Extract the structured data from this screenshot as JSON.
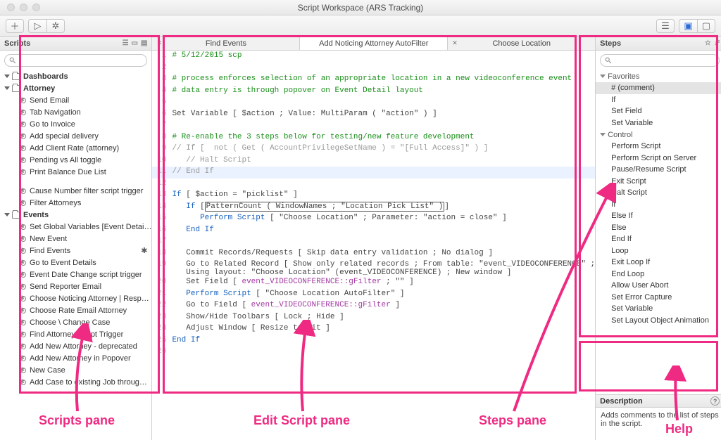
{
  "window": {
    "title": "Script Workspace (ARS Tracking)"
  },
  "scripts": {
    "header": "Scripts",
    "searchPlaceholder": "",
    "folders": [
      {
        "name": "Dashboards",
        "items": []
      },
      {
        "name": "Attorney",
        "items": [
          "Send Email",
          "Tab Navigation",
          "Go to Invoice",
          "Add special delivery",
          "Add Client Rate (attorney)",
          "Pending vs All toggle",
          "Print Balance Due List",
          "",
          "Cause Number filter script trigger",
          "Filter Attorneys"
        ]
      },
      {
        "name": "Events",
        "items": [
          "Set Global Variables [Event Detai…",
          "New Event",
          "Find Events",
          "Go to Event Details",
          "Event Date Change script trigger",
          "Send Reporter Email",
          "Choose Noticing Attorney | Resp…",
          "Choose Rate Email Attorney",
          "Choose \\ Change Case",
          "Find Attorney Script Trigger",
          "Add New Attorney - deprecated",
          "Add New Attorney in Popover",
          "New Case",
          "Add Case to existing Job throug…"
        ],
        "starred": "Find Events"
      }
    ]
  },
  "tabs": [
    {
      "label": "Find Events",
      "closable": true,
      "active": false
    },
    {
      "label": "Add Noticing Attorney AutoFilter",
      "closable": false,
      "active": true
    },
    {
      "label": "Choose Location",
      "closable": true,
      "active": false
    }
  ],
  "code": [
    {
      "n": 1,
      "cls": "c-green",
      "txt": "# 5/12/2015 scp"
    },
    {
      "n": 2,
      "txt": ""
    },
    {
      "n": 3,
      "cls": "c-green",
      "txt": "# process enforces selection of an appropriate location in a new videoconference event"
    },
    {
      "n": 4,
      "cls": "c-green",
      "txt": "# data entry is through popover on Event Detail layout"
    },
    {
      "n": 5,
      "txt": ""
    },
    {
      "n": 6,
      "txt": "Set Variable [ $action ; Value: MultiParam ( \"action\" ) ]"
    },
    {
      "n": 7,
      "txt": ""
    },
    {
      "n": 8,
      "cls": "c-green",
      "txt": "# Re-enable the 3 steps below for testing/new feature development"
    },
    {
      "n": 9,
      "cls": "c-gray",
      "txt": "// If [  not ( Get ( AccountPrivilegeSetName ) = \"[Full Access]\" ) ]"
    },
    {
      "n": 10,
      "cls": "c-gray",
      "txt": "   // Halt Script"
    },
    {
      "n": 11,
      "cls": "c-gray hl",
      "txt": "// End If"
    },
    {
      "n": 12,
      "txt": ""
    },
    {
      "n": 13,
      "segs": [
        {
          "t": "If",
          "c": "c-blue"
        },
        {
          "t": " [ $action = \"picklist\" ]"
        }
      ]
    },
    {
      "n": 14,
      "segs": [
        {
          "t": "   "
        },
        {
          "t": "If",
          "c": "c-blue"
        },
        {
          "t": " ["
        },
        {
          "t": "PatternCount ( WindowNames ; \"Location Pick List\" )",
          "box": true
        },
        {
          "t": "]"
        }
      ]
    },
    {
      "n": 15,
      "segs": [
        {
          "t": "      "
        },
        {
          "t": "Perform Script",
          "c": "c-blue"
        },
        {
          "t": " [ \"Choose Location\" ; Parameter: \"action = close\" ]"
        }
      ]
    },
    {
      "n": 16,
      "segs": [
        {
          "t": "   "
        },
        {
          "t": "End If",
          "c": "c-blue"
        }
      ]
    },
    {
      "n": 17,
      "txt": ""
    },
    {
      "n": 18,
      "txt": "   Commit Records/Requests [ Skip data entry validation ; No dialog ]"
    },
    {
      "n": 19,
      "txt": "   Go to Related Record [ Show only related records ; From table: \"event_VIDEOCONFERENCE\" ;\n   Using layout: \"Choose Location\" (event_VIDEOCONFERENCE) ; New window ]"
    },
    {
      "n": 20,
      "segs": [
        {
          "t": "   Set Field [ "
        },
        {
          "t": "event_VIDEOCONFERENCE::gFilter",
          "c": "c-purple"
        },
        {
          "t": " ; \"\" ]"
        }
      ]
    },
    {
      "n": 21,
      "segs": [
        {
          "t": "   "
        },
        {
          "t": "Perform Script",
          "c": "c-blue"
        },
        {
          "t": " [ \"Choose Location AutoFilter\" ]"
        }
      ]
    },
    {
      "n": 22,
      "segs": [
        {
          "t": "   Go to Field [ "
        },
        {
          "t": "event_VIDEOCONFERENCE::gFilter",
          "c": "c-purple"
        },
        {
          "t": " ]"
        }
      ]
    },
    {
      "n": 23,
      "txt": "   Show/Hide Toolbars [ Lock ; Hide ]"
    },
    {
      "n": 24,
      "txt": "   Adjust Window [ Resize to Fit ]"
    },
    {
      "n": 25,
      "segs": [
        {
          "t": "End If",
          "c": "c-blue"
        }
      ]
    },
    {
      "n": 26,
      "txt": ""
    }
  ],
  "steps": {
    "header": "Steps",
    "groups": [
      {
        "name": "Favorites",
        "items": [
          "# (comment)",
          "If",
          "Set Field",
          "Set Variable"
        ],
        "sel": "# (comment)"
      },
      {
        "name": "Control",
        "items": [
          "Perform Script",
          "Perform Script on Server",
          "Pause/Resume Script",
          "Exit Script",
          "Halt Script",
          "If",
          "Else If",
          "Else",
          "End If",
          "Loop",
          "Exit Loop If",
          "End Loop",
          "Allow User Abort",
          "Set Error Capture",
          "Set Variable",
          "Set Layout Object Animation"
        ]
      }
    ]
  },
  "desc": {
    "header": "Description",
    "body": "Adds comments to the list of steps in the script."
  },
  "ann": {
    "scripts": "Scripts pane",
    "edit": "Edit Script pane",
    "steps": "Steps pane",
    "help": "Help"
  }
}
